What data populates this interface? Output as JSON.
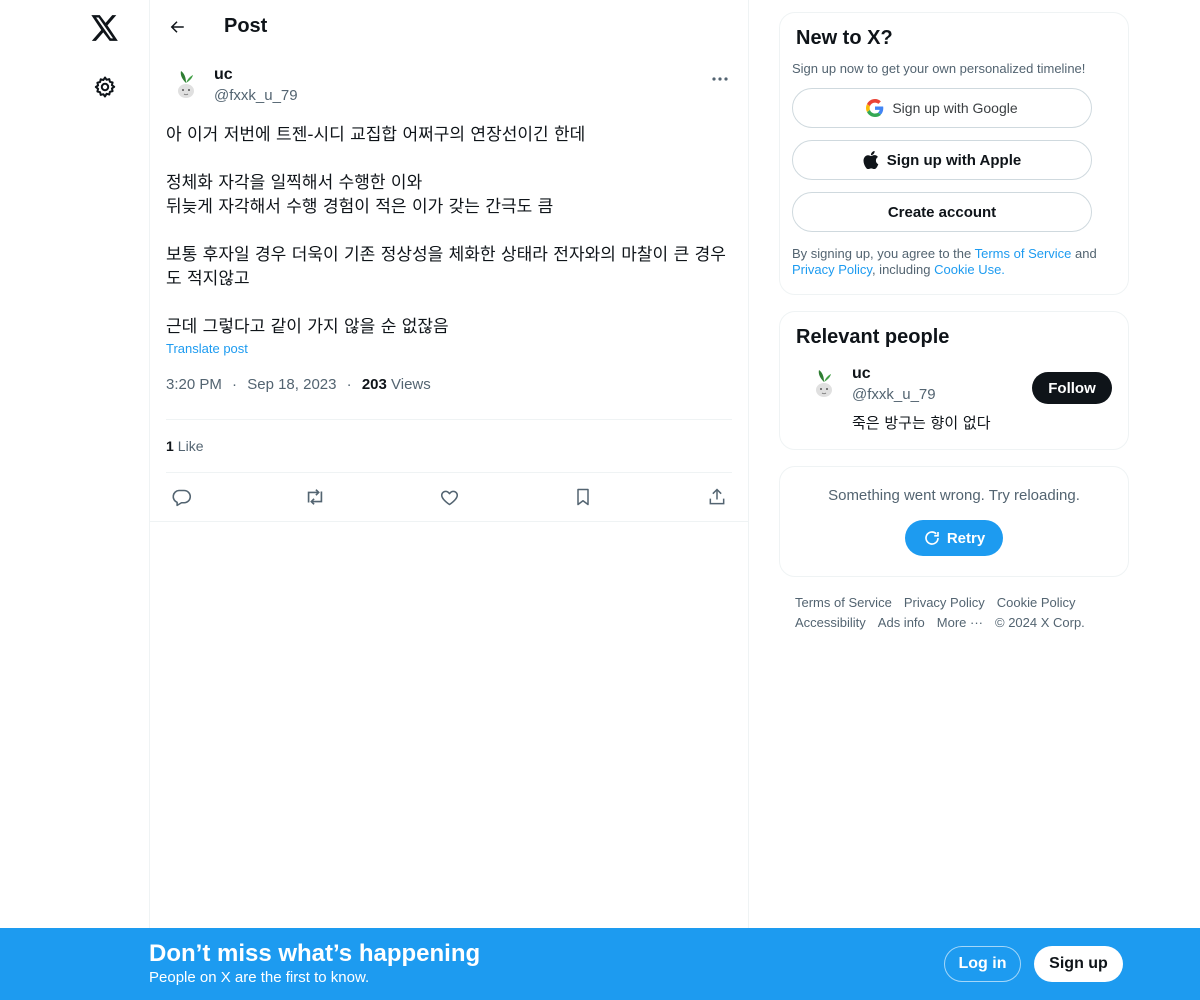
{
  "nav": {
    "logo_icon": "x-logo-icon",
    "settings_icon": "gear-icon"
  },
  "header": {
    "back_icon": "arrow-left-icon",
    "title": "Post"
  },
  "post": {
    "author": {
      "name": "uc",
      "handle": "@fxxk_u_79"
    },
    "text": "아 이거 저번에 트젠-시디 교집합 어쩌구의 연장선이긴 한데\n\n정체화 자각을 일찍해서 수행한 이와\n뒤늦게 자각해서 수행 경험이 적은 이가 갖는 간극도 큼\n\n보통 후자일 경우 더욱이 기존 정상성을 체화한 상태라 전자와의 마찰이 큰 경우도 적지않고\n\n근데 그렇다고 같이 가지 않을 순 없잖음",
    "translate_label": "Translate post",
    "time": "3:20 PM",
    "date": "Sep 18, 2023",
    "views_count": "203",
    "views_label": "Views",
    "likes_count": "1",
    "likes_label": "Like",
    "separator": "·"
  },
  "new_to_x": {
    "title": "New to X?",
    "subtitle": "Sign up now to get your own personalized timeline!",
    "google_label": "Sign up with Google",
    "apple_label": "Sign up with Apple",
    "create_label": "Create account",
    "terms_prefix": "By signing up, you agree to the ",
    "terms_link": "Terms of Service",
    "terms_and": " and ",
    "privacy_link": "Privacy Policy",
    "terms_including": ", including ",
    "cookie_link": "Cookie Use."
  },
  "relevant": {
    "title": "Relevant people",
    "name": "uc",
    "handle": "@fxxk_u_79",
    "bio": "죽은 방구는 향이 없다",
    "follow_label": "Follow"
  },
  "error_card": {
    "message": "Something went wrong. Try reloading.",
    "retry_label": "Retry"
  },
  "footer": {
    "terms": "Terms of Service",
    "privacy": "Privacy Policy",
    "cookie": "Cookie Policy",
    "accessibility": "Accessibility",
    "ads": "Ads info",
    "more": "More ···",
    "copyright": "© 2024 X Corp."
  },
  "bottom_bar": {
    "title": "Don’t miss what’s happening",
    "subtitle": "People on X are the first to know.",
    "login_label": "Log in",
    "signup_label": "Sign up"
  },
  "colors": {
    "accent": "#1d9bf0",
    "text": "#0f1419",
    "muted": "#536471"
  }
}
